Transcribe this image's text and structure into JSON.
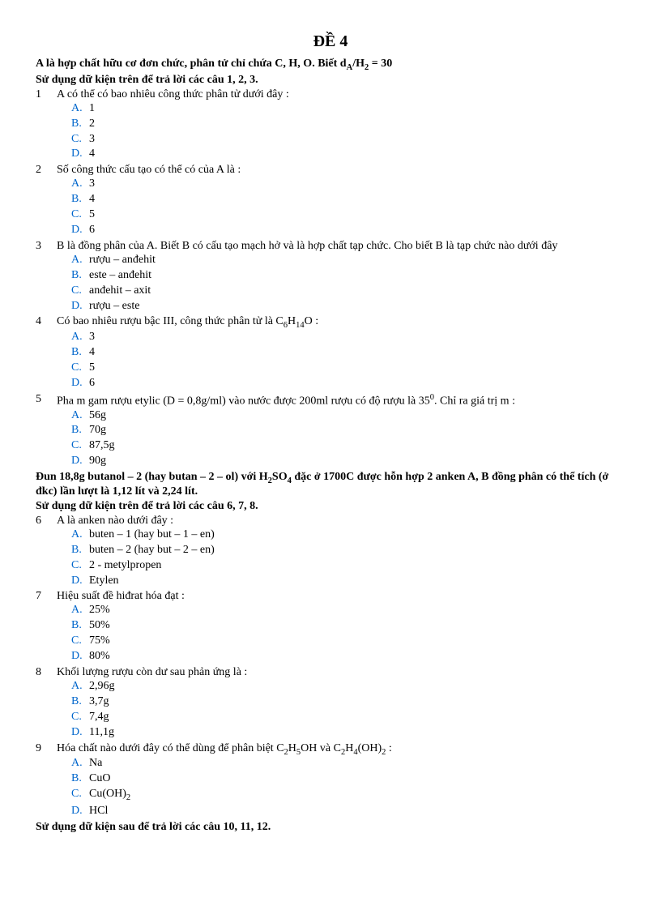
{
  "title": "ĐỀ 4",
  "intro1": "A là hợp chất hữu cơ đơn chức, phân tử chỉ chứa C, H, O. Biết d_A/H_2 = 30",
  "intro1_html": "A là hợp chất hữu cơ đơn chức, phân tử chỉ chứa C, H, O. Biết d<sub>A</sub>/H<sub>2</sub> = 30",
  "instr1": "Sử dụng dữ kiện trên để trả lời các câu 1, 2, 3.",
  "intro2_html": "Đun 18,8g butanol – 2 (hay butan – 2 – ol) với H<sub>2</sub>SO<sub>4</sub> đặc ở 1700C được hỗn hợp 2 anken A, B đồng phân có thể tích (ở đkc) lần lượt là 1,12 lít và 2,24 lít.",
  "instr2": "Sử dụng dữ kiện trên để trả lời các câu 6, 7, 8.",
  "instr3": "Sử dụng dữ kiện sau để trả lời các câu 10, 11, 12.",
  "questions": [
    {
      "num": "1",
      "text": "A có thể có bao nhiêu công thức phân tử dưới đây :",
      "choices": [
        {
          "label": "A.",
          "text": "1"
        },
        {
          "label": "B.",
          "text": "2"
        },
        {
          "label": "C.",
          "text": "3"
        },
        {
          "label": "D.",
          "text": "4"
        }
      ]
    },
    {
      "num": "2",
      "text": "Số công thức cấu tạo có thể có của A là :",
      "choices": [
        {
          "label": "A.",
          "text": "3"
        },
        {
          "label": "B.",
          "text": "4"
        },
        {
          "label": "C.",
          "text": "5"
        },
        {
          "label": "D.",
          "text": "6"
        }
      ]
    },
    {
      "num": "3",
      "text": "B là đồng phân của A. Biết B có cấu tạo mạch hở và là hợp chất tạp chức. Cho biết B là tạp chức nào dưới đây",
      "choices": [
        {
          "label": "A.",
          "text": "rượu – anđehit"
        },
        {
          "label": "B.",
          "text": "este – anđehit"
        },
        {
          "label": "C.",
          "text": "anđehit – axit"
        },
        {
          "label": "D.",
          "text": "rượu – este"
        }
      ]
    },
    {
      "num": "4",
      "text_html": "Có bao nhiêu rượu bậc III, công thức phân tử là C<sub>6</sub>H<sub>14</sub>O :",
      "choices": [
        {
          "label": "A.",
          "text": "3"
        },
        {
          "label": "B.",
          "text": "4"
        },
        {
          "label": "C.",
          "text": "5"
        },
        {
          "label": "D.",
          "text": "6"
        }
      ]
    },
    {
      "num": "5",
      "text_html": "Pha m gam rượu etylic (D = 0,8g/ml) vào nước được 200ml rượu có độ rượu là 35<sup>0</sup>. Chỉ ra giá trị m :",
      "choices": [
        {
          "label": "A.",
          "text": "56g"
        },
        {
          "label": "B.",
          "text": "70g"
        },
        {
          "label": "C.",
          "text": "87,5g"
        },
        {
          "label": "D.",
          "text": "90g"
        }
      ]
    },
    {
      "num": "6",
      "text": "A là anken nào dưới đây :",
      "choices": [
        {
          "label": "A.",
          "text": "buten – 1 (hay but – 1 – en)"
        },
        {
          "label": "B.",
          "text": "buten – 2 (hay but – 2 – en)"
        },
        {
          "label": "C.",
          "text": "2 - metylpropen"
        },
        {
          "label": "D.",
          "text": "Etylen"
        }
      ]
    },
    {
      "num": "7",
      "text": "Hiệu suất đề hiđrat hóa đạt :",
      "choices": [
        {
          "label": "A.",
          "text": "25%"
        },
        {
          "label": "B.",
          "text": "50%"
        },
        {
          "label": "C.",
          "text": "75%"
        },
        {
          "label": "D.",
          "text": "80%"
        }
      ]
    },
    {
      "num": "8",
      "text": "Khối lượng rượu còn dư sau phản ứng là :",
      "choices": [
        {
          "label": "A.",
          "text": "2,96g"
        },
        {
          "label": "B.",
          "text": "3,7g"
        },
        {
          "label": "C.",
          "text": "7,4g"
        },
        {
          "label": "D.",
          "text": "11,1g"
        }
      ]
    },
    {
      "num": "9",
      "text_html": "Hóa chất nào dưới đây có thể dùng để phân biệt C<sub>2</sub>H<sub>5</sub>OH và C<sub>2</sub>H<sub>4</sub>(OH)<sub>2</sub> :",
      "choices": [
        {
          "label": "A.",
          "text": "Na"
        },
        {
          "label": "B.",
          "text": "CuO"
        },
        {
          "label": "C.",
          "text_html": "Cu(OH)<sub>2</sub>"
        },
        {
          "label": "D.",
          "text": "HCl"
        }
      ]
    }
  ]
}
